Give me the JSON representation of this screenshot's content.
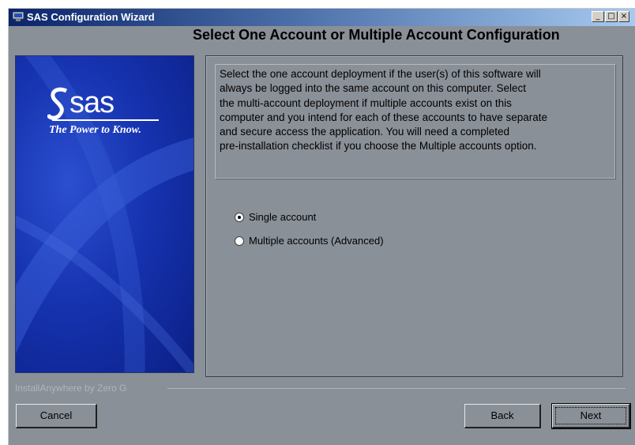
{
  "window": {
    "title": "SAS Configuration Wizard",
    "controls": [
      "_",
      "□",
      "×"
    ]
  },
  "header": {
    "title": "Select  One Account  or Multiple Account Configuration"
  },
  "branding": {
    "logo_text": "sas",
    "tagline": "The Power to Know."
  },
  "description": {
    "lines": [
      "Select  the one account deployment if the user(s) of this software will",
      "always be logged into the same account on this computer.  Select",
      "the multi-account deployment if multiple accounts exist on this",
      "computer and you intend for each of these accounts to have separate",
      "and secure access the application. You will need a completed",
      "pre-installation checklist if you choose the Multiple accounts option."
    ]
  },
  "options": {
    "single": {
      "label": "Single account",
      "selected": true
    },
    "multiple": {
      "label": "Multiple accounts (Advanced)",
      "selected": false
    }
  },
  "footer": {
    "vendor_label": "InstallAnywhere by Zero G",
    "cancel_label": "Cancel",
    "back_label": "Back",
    "next_label": "Next"
  }
}
